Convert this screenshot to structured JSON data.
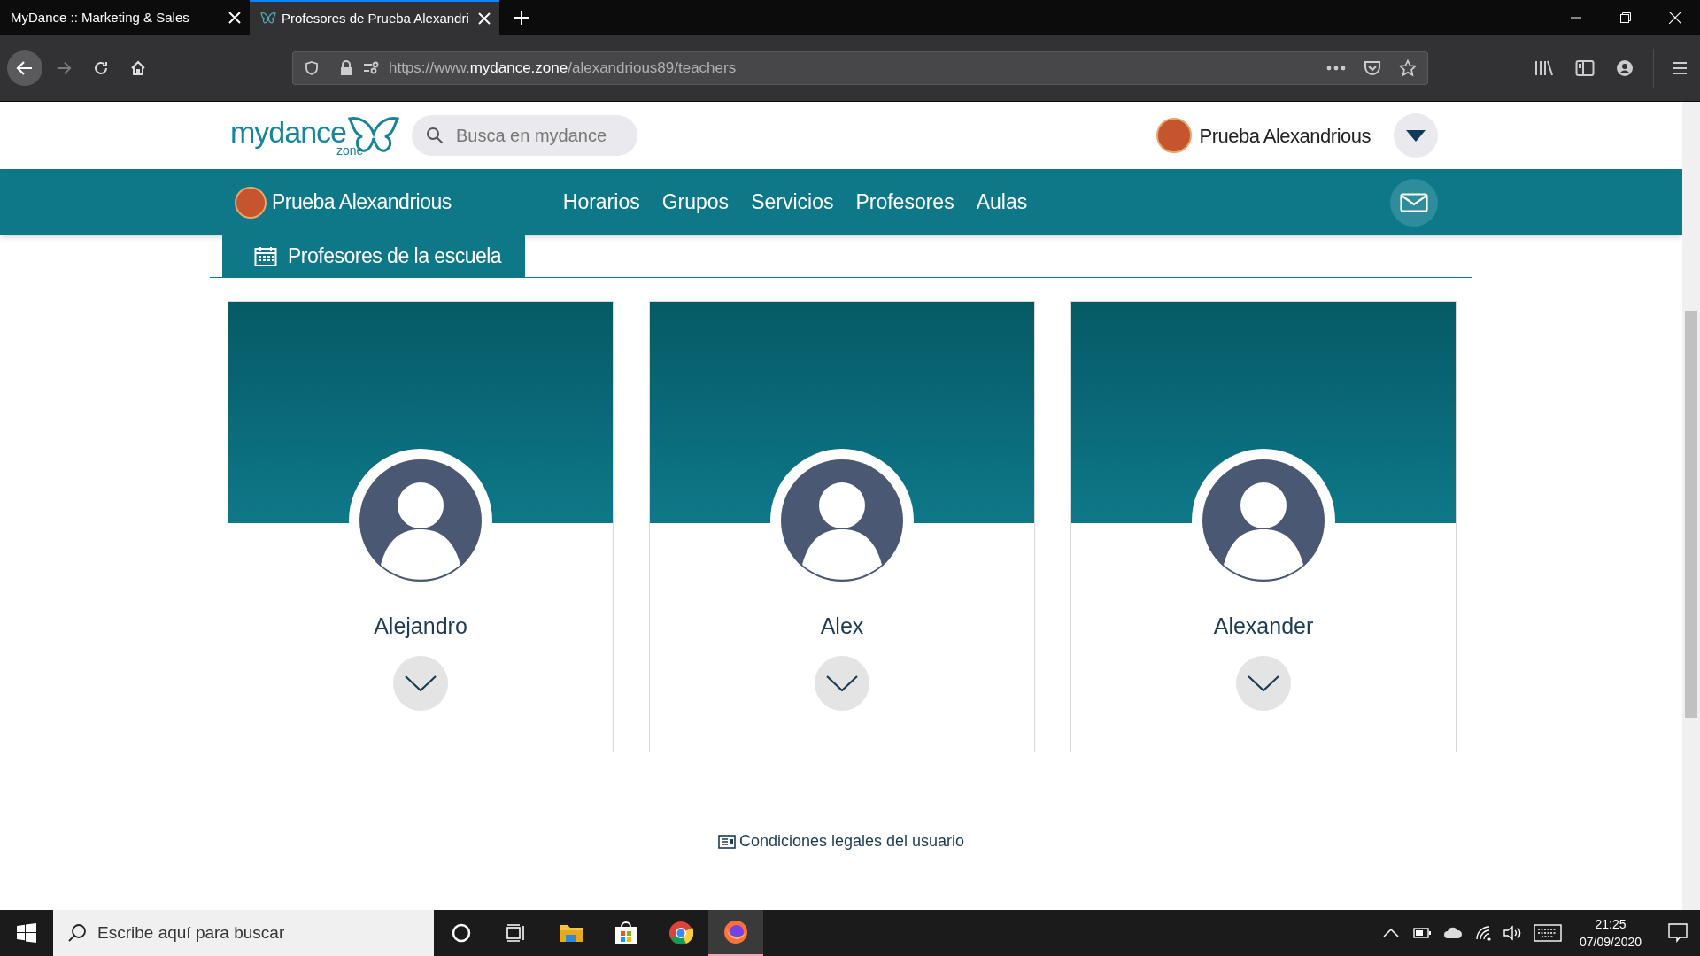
{
  "browser": {
    "tabs": [
      {
        "title": "MyDance :: Marketing & Sales",
        "selected": false
      },
      {
        "title": "Profesores de Prueba Alexandri",
        "selected": true
      }
    ],
    "url": {
      "prefix": "https://www.",
      "domain": "mydance.zone",
      "path": "/alexandrious89/teachers"
    }
  },
  "site_header": {
    "logo": {
      "word": "mydance",
      "sub": "zone"
    },
    "search": {
      "placeholder": "Busca en mydance"
    },
    "user_name": "Prueba Alexandrious"
  },
  "nav": {
    "school_name": "Prueba Alexandrious",
    "links": [
      "Horarios",
      "Grupos",
      "Servicios",
      "Profesores",
      "Aulas"
    ]
  },
  "section_tab": {
    "title": "Profesores de la escuela"
  },
  "teachers": [
    {
      "name": "Alejandro"
    },
    {
      "name": "Alex"
    },
    {
      "name": "Alexander"
    }
  ],
  "footer_link": "Condiciones legales del usuario",
  "taskbar": {
    "search": {
      "placeholder": "Escribe aquí para buscar"
    },
    "time": "21:25",
    "date": "07/09/2020"
  }
}
